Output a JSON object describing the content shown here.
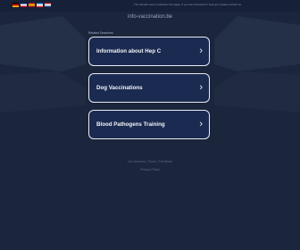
{
  "topbar": {
    "flags": [
      {
        "name": "german-flag-icon",
        "colors": [
          "#000000",
          "#dd0000",
          "#ffce00"
        ]
      },
      {
        "name": "british-flag-icon",
        "colors": [
          "#012169",
          "#ffffff",
          "#c8102e"
        ]
      },
      {
        "name": "spanish-flag-icon",
        "colors": [
          "#aa151b",
          "#f1bf00",
          "#aa151b"
        ]
      },
      {
        "name": "french-flag-icon",
        "colors": [
          "#0055a4",
          "#ffffff",
          "#ef4135"
        ]
      },
      {
        "name": "dutch-flag-icon",
        "colors": [
          "#ae1c28",
          "#ffffff",
          "#21468b"
        ]
      }
    ],
    "notice": "The domain owner maintains this page. If you are interested in buying it, please contact us."
  },
  "domain": "info-vaccination.be",
  "related_label": "Related Searches",
  "links": [
    {
      "label": "Information about Hep C"
    },
    {
      "label": "Dog Vaccinations"
    },
    {
      "label": "Blood Pathogens Training"
    }
  ],
  "footer": {
    "links_text": "Our services  |  Terms  |  Feedback",
    "policy_text": "Privacy Policy"
  },
  "colors": {
    "background": "#1b253b",
    "link_box_bg": "#1a2a50",
    "link_box_border": "#e7ecf4"
  }
}
